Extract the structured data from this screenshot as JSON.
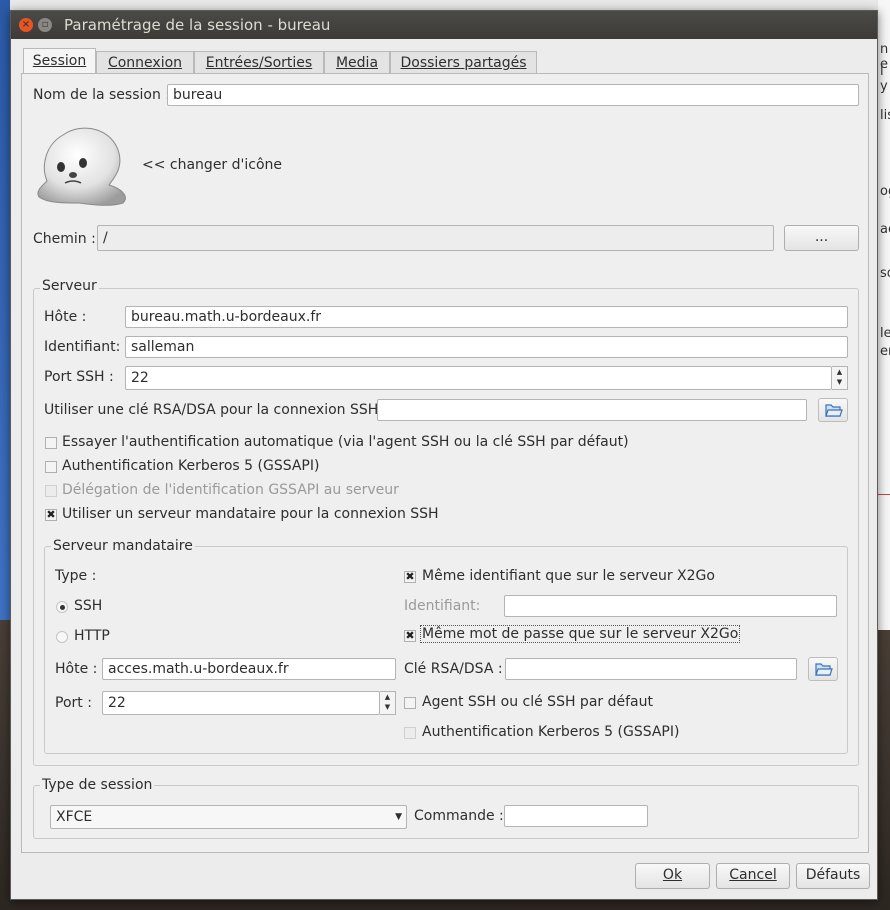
{
  "window": {
    "title": "Paramétrage de la session - bureau"
  },
  "tabs": [
    {
      "label": "Session",
      "active": true
    },
    {
      "label": "Connexion"
    },
    {
      "label": "Entrées/Sorties"
    },
    {
      "label": "Media"
    },
    {
      "label": "Dossiers partagés"
    }
  ],
  "session": {
    "name_label": "Nom de la session :",
    "name_value": "bureau",
    "change_icon_label": "<< changer d'icône",
    "path_label": "Chemin :",
    "path_value": "/",
    "browse_label": "..."
  },
  "server": {
    "group_title": "Serveur",
    "host_label": "Hôte :",
    "host_value": "bureau.math.u-bordeaux.fr",
    "login_label": "Identifiant:",
    "login_value": "salleman",
    "port_label": "Port SSH :",
    "port_value": "22",
    "rsa_label": "Utiliser une clé RSA/DSA pour la connexion SSH :",
    "rsa_value": "",
    "auto_auth_label": "Essayer l'authentification automatique (via l'agent SSH ou la clé SSH par défaut)",
    "kerberos_label": "Authentification Kerberos 5 (GSSAPI)",
    "delegation_label": "Délégation de l'identification GSSAPI au serveur",
    "proxy_label": "Utiliser un serveur mandataire pour la connexion SSH"
  },
  "proxy": {
    "group_title": "Serveur mandataire",
    "type_label": "Type :",
    "ssh_label": "SSH",
    "http_label": "HTTP",
    "host_label": "Hôte :",
    "host_value": "acces.math.u-bordeaux.fr",
    "port_label": "Port :",
    "port_value": "22",
    "same_login_label": "Même identifiant que sur le serveur X2Go",
    "login_label": "Identifiant:",
    "login_value": "",
    "same_password_label": "Même mot de passe que sur le serveur X2Go",
    "rsa_label": "Clé RSA/DSA :",
    "rsa_value": "",
    "agent_label": "Agent SSH ou clé SSH par défaut",
    "kerberos_label": "Authentification Kerberos 5 (GSSAPI)"
  },
  "session_type": {
    "group_title": "Type de session",
    "selected": "XFCE",
    "command_label": "Commande :",
    "command_value": ""
  },
  "buttons": {
    "ok": "Ok",
    "cancel": "Cancel",
    "defaults": "Défauts"
  },
  "background": {
    "fragments": [
      "n e",
      "l y",
      "lis",
      "og",
      "ac",
      "so",
      "le",
      "er"
    ]
  }
}
